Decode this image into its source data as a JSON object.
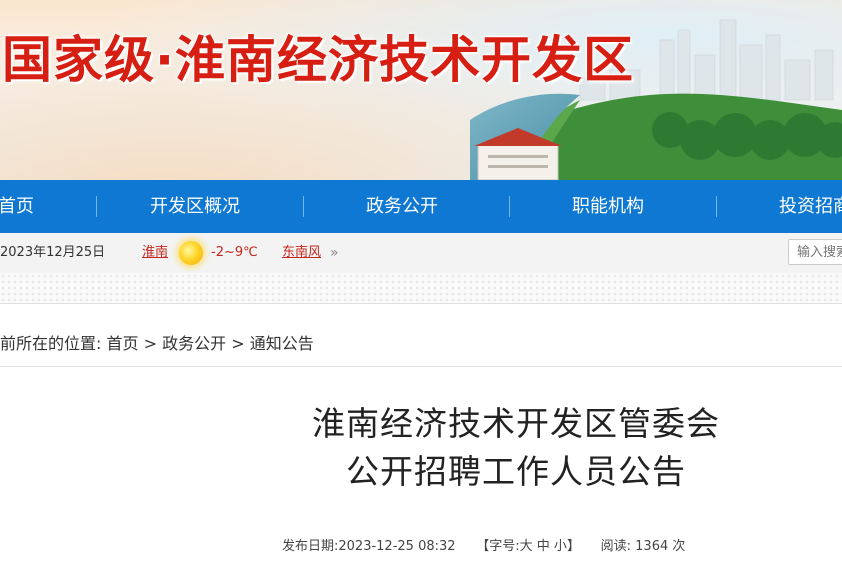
{
  "banner": {
    "title": "国家级·淮南经济技术开发区"
  },
  "nav": {
    "items": [
      "首页",
      "开发区概况",
      "政务公开",
      "职能机构",
      "投资招商"
    ]
  },
  "infobar": {
    "date": "2023年12月25日",
    "weather_city": "淮南",
    "weather_icon": "sun-icon",
    "temperature": "-2~9℃",
    "wind": "东南风",
    "more_glyph": "»",
    "search_placeholder": "输入搜索"
  },
  "breadcrumb": {
    "prefix": "前所在的位置:",
    "home": "首页",
    "sep": " > ",
    "section": "政务公开",
    "current": "通知公告"
  },
  "article": {
    "title_line1": "淮南经济技术开发区管委会",
    "title_line2": "公开招聘工作人员公告",
    "meta": {
      "publish_label": "发布日期:",
      "publish_value": "2023-12-25 08:32",
      "fontsize_open": "【字号:",
      "size_large": "大",
      "size_medium": "中",
      "size_small": "小",
      "fontsize_close": "】",
      "reads_label": "阅读:",
      "reads_value": "1364",
      "reads_unit": "次"
    }
  },
  "colors": {
    "title_red": "#d61e12",
    "nav_blue": "#0f78d2",
    "weather_red": "#c6251b"
  }
}
